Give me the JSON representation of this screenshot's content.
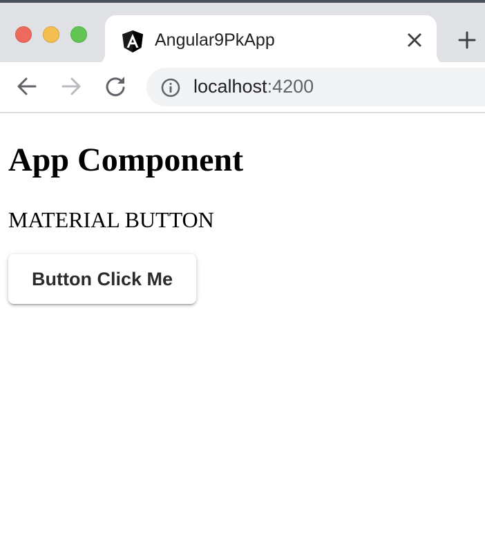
{
  "browser": {
    "tab": {
      "title": "Angular9PkApp",
      "favicon": "angular-logo-icon"
    },
    "address_bar": {
      "host": "localhost",
      "port": ":4200"
    },
    "icons": {
      "close": "close-icon",
      "new_tab": "plus-icon",
      "back": "arrow-left-icon",
      "forward": "arrow-right-icon",
      "reload": "reload-icon",
      "info": "info-icon"
    },
    "colors": {
      "traffic_red": "#ed6a5e",
      "traffic_yellow": "#f5bf4f",
      "traffic_green": "#62c554",
      "titlebar": "#dfe1e5",
      "omnibox": "#f1f3f4"
    }
  },
  "page": {
    "heading": "App Component",
    "subtitle": "MATERIAL BUTTON",
    "button_label": "Button Click Me"
  }
}
